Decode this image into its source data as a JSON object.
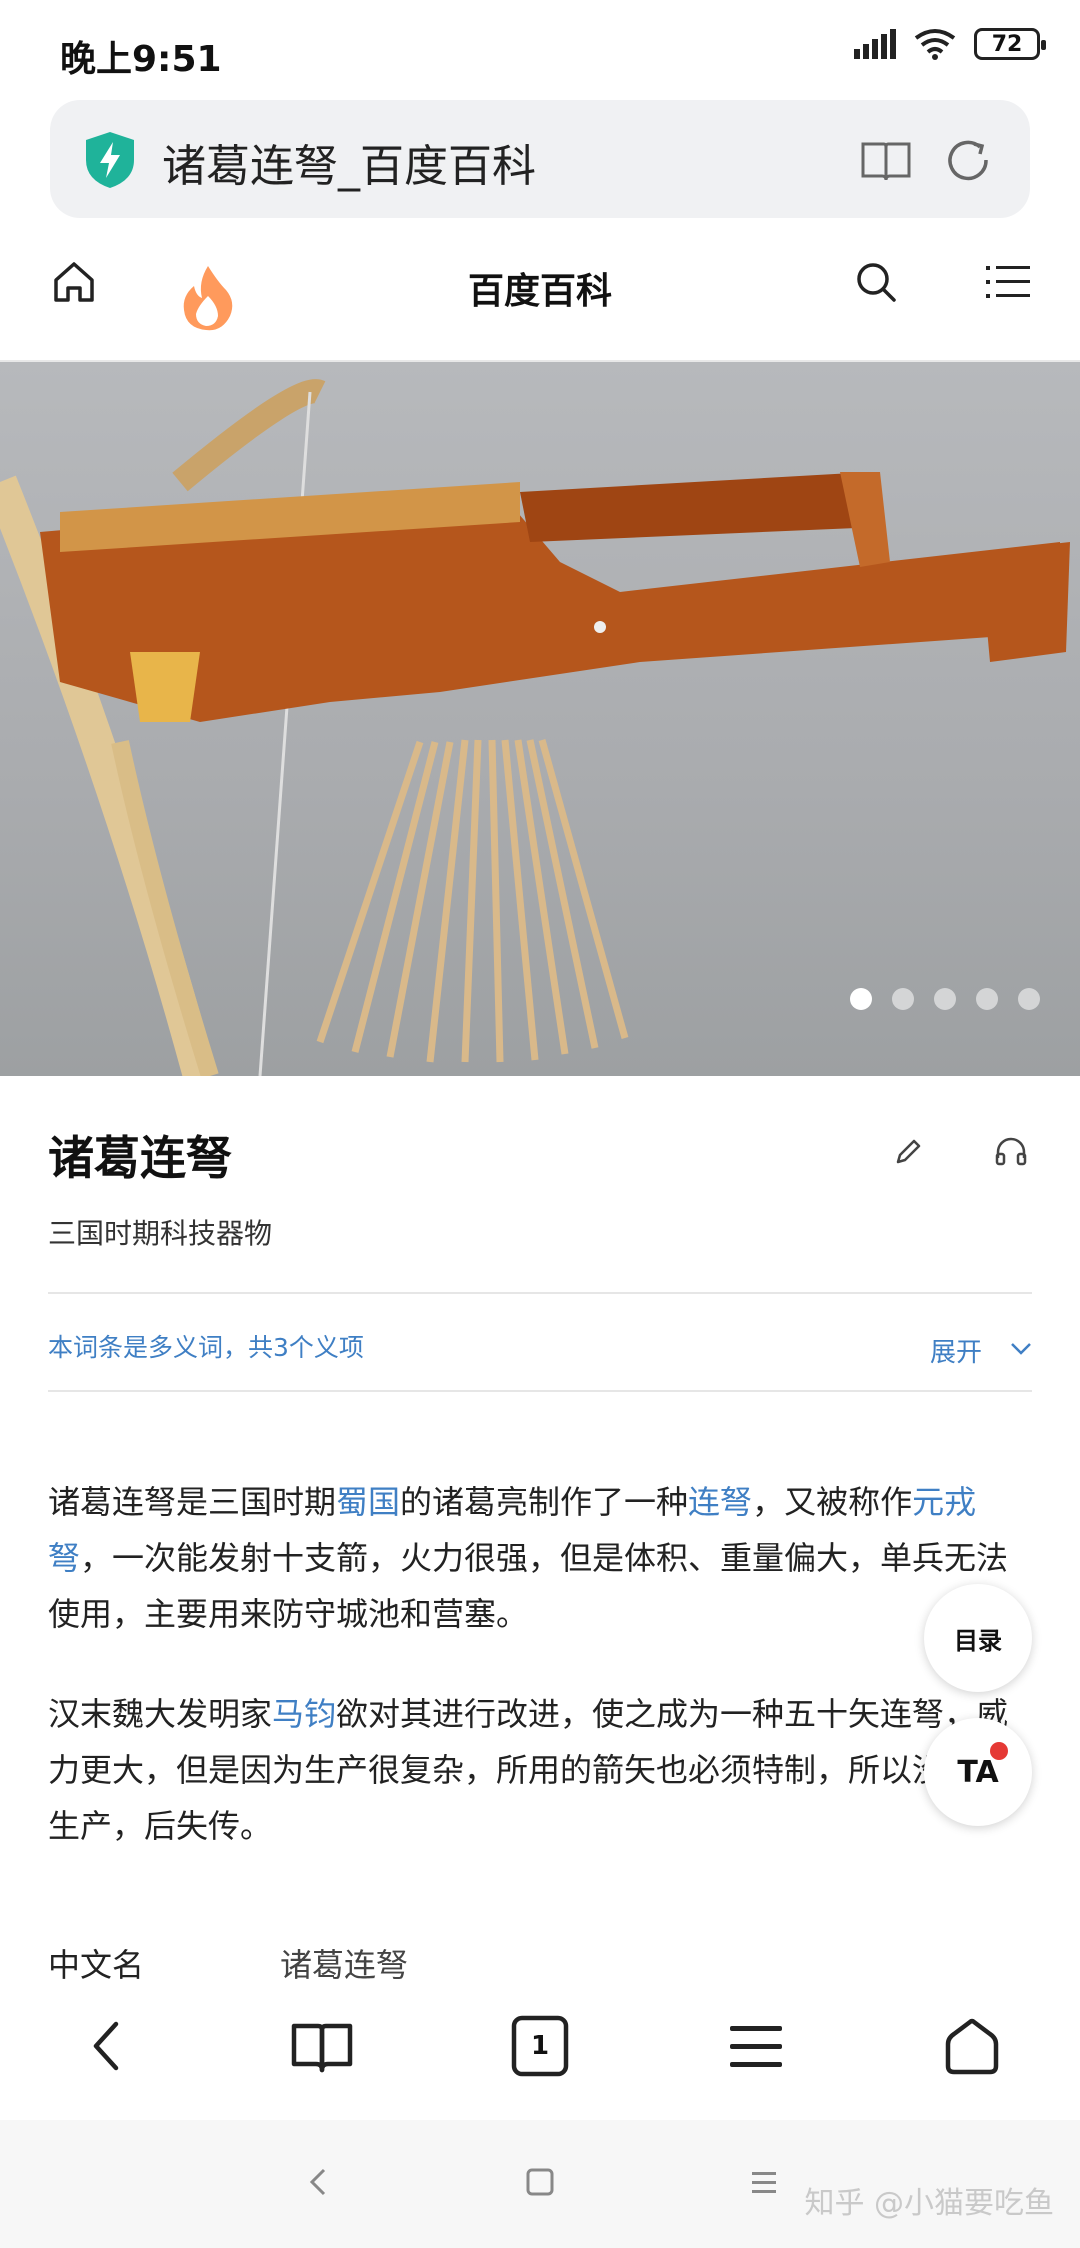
{
  "status_bar": {
    "time": "晚上9:51",
    "battery": "72"
  },
  "address_bar": {
    "title": "诸葛连弩_百度百科"
  },
  "site_nav": {
    "title": "百度百科"
  },
  "hero": {
    "dots_count": 5,
    "active_index": 0
  },
  "entry": {
    "title": "诸葛连弩",
    "subtitle": "三国时期科技器物",
    "polysemy_note": "本词条是多义词，共3个义项",
    "expand_label": "展开"
  },
  "paragraphs": {
    "p1": {
      "t1": "诸葛连弩是三国时期",
      "l1": "蜀国",
      "t2": "的诸葛亮制作了一种",
      "l2": "连弩",
      "t3": "，又被称作",
      "l3": "元戎弩",
      "t4": "，一次能发射十支箭，火力很强，但是体积、重量偏大，单兵无法使用，主要用来防守城池和营塞。"
    },
    "p2": {
      "t1": "汉末魏大发明家",
      "l1": "马钧",
      "t2": "欲对其进行改进，使之成为一种五十矢连弩，威力更大，但是因为生产很复杂，所用的箭矢也必须特制，所以没大量生产，后失传。"
    }
  },
  "info_row": {
    "label": "中文名",
    "value": "诸葛连弩"
  },
  "floating": {
    "toc_label": "目录",
    "ta_label": "TA"
  },
  "toolbar": {
    "tab_count": "1"
  },
  "watermark": "知乎 @小猫要吃鱼"
}
